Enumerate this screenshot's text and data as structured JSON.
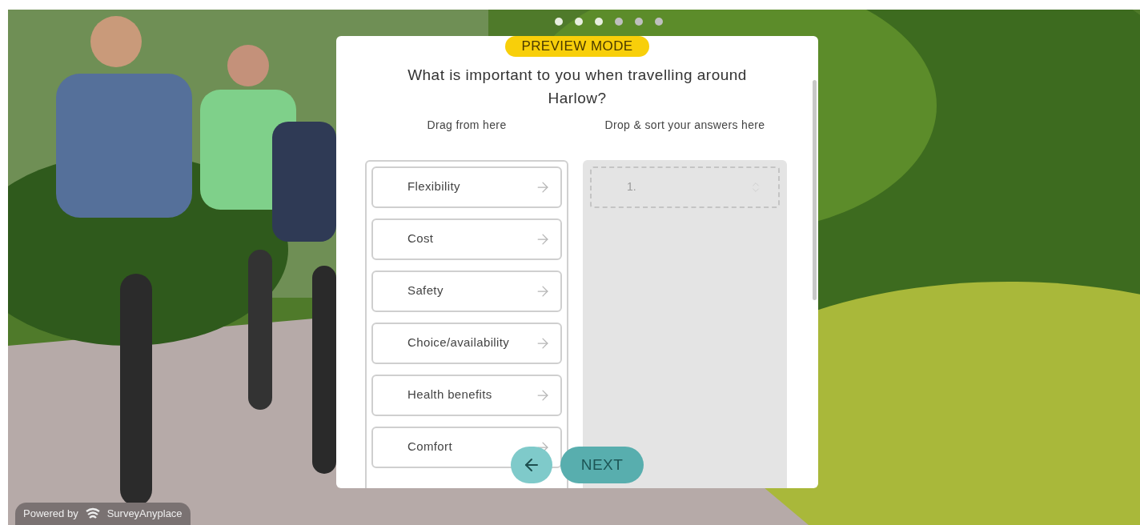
{
  "preview_badge": "PREVIEW MODE",
  "question": "What is important to you when travelling around Harlow?",
  "source_heading": "Drag from here",
  "target_heading": "Drop & sort your answers here",
  "options": [
    "Flexibility",
    "Cost",
    "Safety",
    "Choice/availability",
    "Health benefits",
    "Comfort"
  ],
  "drop_slots": [
    "1."
  ],
  "next_button": "NEXT",
  "footer": {
    "powered_by": "Powered by",
    "brand": "SurveyAnyplace"
  }
}
